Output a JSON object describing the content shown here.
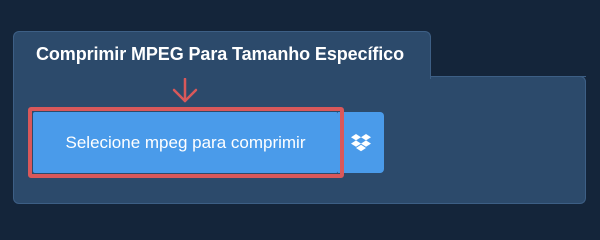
{
  "panel": {
    "title": "Comprimir MPEG Para Tamanho Específico"
  },
  "upload": {
    "select_label": "Selecione mpeg para comprimir",
    "dropbox_icon": "dropbox-icon",
    "arrow_icon": "arrow-down-icon"
  },
  "colors": {
    "background": "#14253a",
    "panel": "#2c4a6b",
    "button": "#4a9bea",
    "highlight": "#d9585a"
  }
}
